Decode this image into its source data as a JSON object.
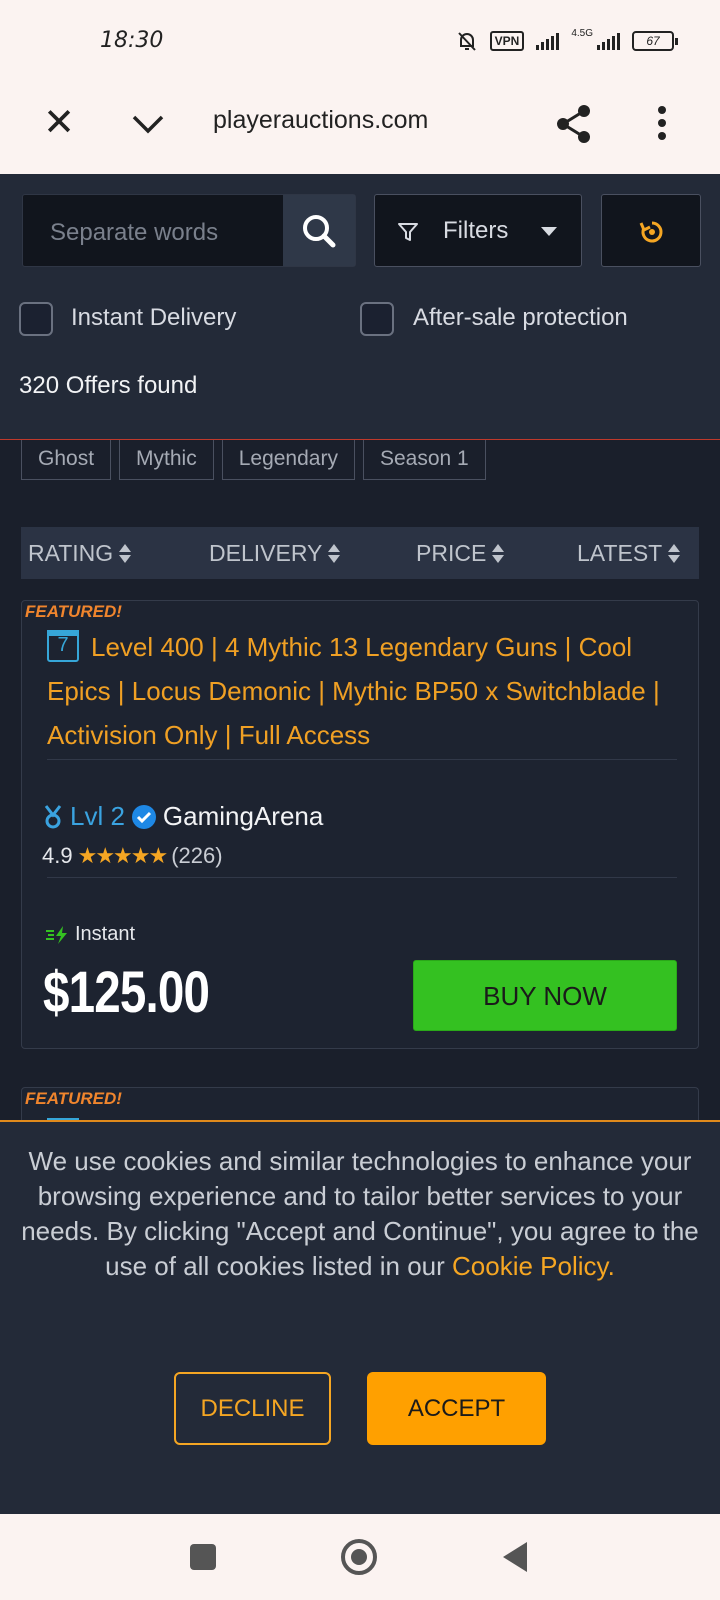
{
  "status_bar": {
    "time": "18:30",
    "vpn": "VPN",
    "network": "4.5G",
    "battery": "67"
  },
  "browser": {
    "url": "playerauctions.com"
  },
  "search": {
    "placeholder": "Separate words"
  },
  "filters": {
    "label": "Filters"
  },
  "checkboxes": {
    "instant_delivery": "Instant Delivery",
    "after_sale": "After-sale protection"
  },
  "results": {
    "count_text": "320 Offers found"
  },
  "tags": [
    "Ghost",
    "Mythic",
    "Legendary",
    "Season 1"
  ],
  "sort": {
    "rating": "RATING",
    "delivery": "DELIVERY",
    "price": "PRICE",
    "latest": "LATEST"
  },
  "listing": {
    "badge": "FEATURED!",
    "calendar_day": "7",
    "title": "Level 400 | 4 Mythic 13 Legendary Guns | Cool Epics | Locus Demonic | Mythic BP50 x Switchblade | Activision Only | Full Access",
    "seller_level": "Lvl 2",
    "seller_name": "GamingArena",
    "rating": "4.9",
    "stars": "★★★★★",
    "star_count": 5,
    "review_count": "(226)",
    "delivery": "Instant",
    "price": "$125.00",
    "buy_label": "BUY NOW"
  },
  "listing2": {
    "badge": "FEATURED!"
  },
  "cookie": {
    "text": "We use cookies and similar technologies to enhance your browsing experience and to tailor better services to your needs. By clicking \"Accept and Continue\", you agree to the use of all cookies listed in our ",
    "link": "Cookie Policy.",
    "decline": "DECLINE",
    "accept": "ACCEPT"
  },
  "colors": {
    "accent_orange": "#f0a024",
    "buy_green": "#34c121",
    "link_blue": "#3aa3e0"
  },
  "icons": [
    "mute-bell-icon",
    "signal-icon",
    "battery-icon",
    "close-icon",
    "chevron-down-icon",
    "share-icon",
    "more-vert-icon",
    "search-icon",
    "funnel-icon",
    "caret-down-icon",
    "reset-icon",
    "calendar-icon",
    "medal-icon",
    "verified-icon",
    "bolt-icon",
    "nav-recents-icon",
    "nav-home-icon",
    "nav-back-icon"
  ]
}
